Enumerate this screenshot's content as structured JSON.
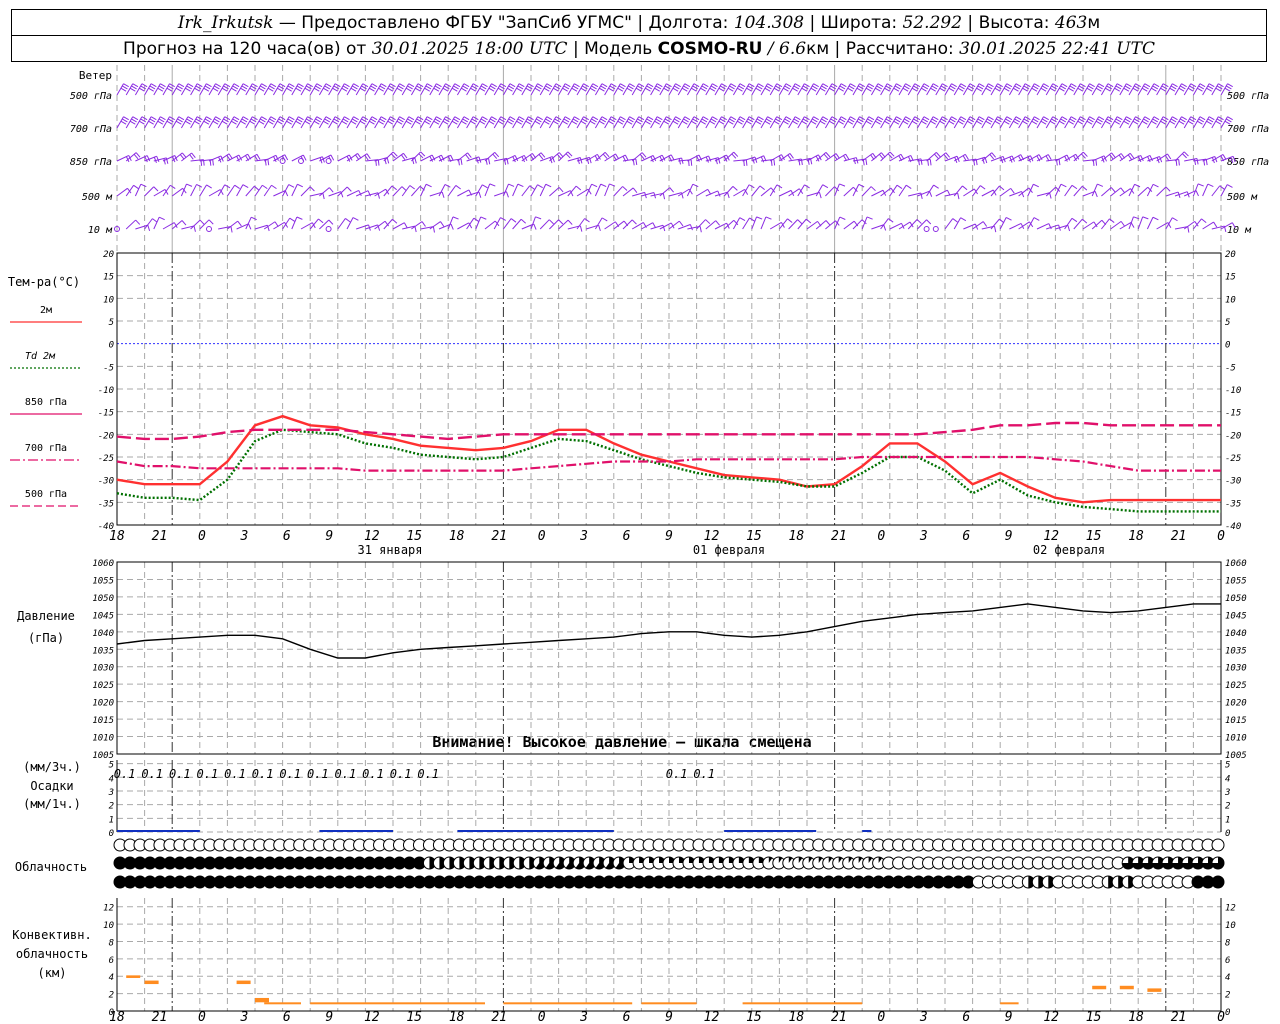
{
  "header": {
    "station": "Irk_Irkutsk",
    "provider": "— Предоставлено ФГБУ \"ЗапСиб УГМС\"",
    "lon_label": "Долгота:",
    "lon_value": "104.308",
    "lat_label": "Широта:",
    "lat_value": "52.292",
    "alt_label": "Высота:",
    "alt_value": "463",
    "alt_unit": "м",
    "forecast_label": "Прогноз на 120 часа(ов) от",
    "forecast_start": "30.01.2025 18:00 UTC",
    "model_label": "Модель",
    "model_name": "COSMO-RU",
    "model_res": "/ 6.6",
    "model_res_unit": "км",
    "computed_label": "Рассчитано:",
    "computed_value": "30.01.2025 22:41 UTC"
  },
  "wind_panel": {
    "title": "Ветер",
    "levels": [
      "500 гПа",
      "700 гПа",
      "850 гПа",
      "500 м",
      "10 м"
    ],
    "color": "#8a2be2"
  },
  "temp_panel": {
    "title": "Тем-ра(°C)",
    "legend": [
      {
        "label": "2м",
        "color": "#ff3030",
        "dash": "solid"
      },
      {
        "label": "Td 2м",
        "color": "#007000",
        "dash": "dot"
      },
      {
        "label": "850 гПа",
        "color": "#e0106a",
        "dash": "solid"
      },
      {
        "label": "700 гПа",
        "color": "#e0106a",
        "dash": "dashdot"
      },
      {
        "label": "500 гПа",
        "color": "#e0106a",
        "dash": "dash"
      }
    ],
    "yticks": [
      "20",
      "15",
      "10",
      "5",
      "0",
      "-5",
      "-10",
      "-15",
      "-20",
      "-25",
      "-30",
      "-35",
      "-40"
    ]
  },
  "x_axis": {
    "hour_labels": [
      "18",
      "21",
      "0",
      "3",
      "6",
      "9",
      "12",
      "15",
      "18",
      "21",
      "0",
      "3",
      "6",
      "9",
      "12",
      "15",
      "18",
      "21",
      "0",
      "3",
      "6",
      "9",
      "12",
      "15",
      "18",
      "21",
      "0"
    ],
    "date_labels": [
      "31 января",
      "01 февраля",
      "02 февраля"
    ]
  },
  "pressure_panel": {
    "title": "Давление",
    "unit": "(гПа)",
    "yticks": [
      "1060",
      "1055",
      "1050",
      "1045",
      "1040",
      "1035",
      "1030",
      "1025",
      "1020",
      "1015",
      "1010",
      "1005"
    ],
    "warning": "Внимание! Высокое давление — шкала смещена"
  },
  "precip_panel": {
    "label_3h": "(мм/3ч.)",
    "title": "Осадки",
    "label_1h": "(мм/1ч.)",
    "yticks": [
      "5",
      "4",
      "3",
      "2",
      "1",
      "0"
    ],
    "amounts": [
      "0.1",
      "0.1",
      "0.1",
      "0.1",
      "0.1",
      "0.1",
      "0.1",
      "0.1",
      "0.1",
      "0.1",
      "0.1",
      "0.1",
      "0.1",
      "0.1"
    ]
  },
  "cloud_panel": {
    "title": "Облачность"
  },
  "conv_panel": {
    "title_1": "Конвективн.",
    "title_2": "облачность",
    "unit": "(км)",
    "yticks": [
      "12",
      "10",
      "8",
      "6",
      "4",
      "2",
      "0"
    ]
  },
  "chart_data": [
    {
      "type": "line",
      "title": "Тем-ра(°C)",
      "x_hours": [
        0,
        3,
        6,
        9,
        12,
        15,
        18,
        21,
        24,
        27,
        30,
        33,
        36,
        39,
        42,
        45,
        48,
        51,
        54,
        57,
        60,
        63,
        66,
        69,
        72,
        75,
        78,
        81,
        84,
        87,
        90,
        93,
        96,
        99,
        102,
        105,
        108,
        111,
        114,
        117,
        120
      ],
      "ylim": [
        -40,
        20
      ],
      "series": [
        {
          "name": "2м",
          "values": [
            -30,
            -31,
            -31,
            -31,
            -26,
            -18,
            -16,
            -18,
            -18.5,
            -20,
            -21,
            -22.5,
            -23,
            -23.5,
            -23,
            -21.5,
            -19,
            -19,
            -22,
            -24.5,
            -26,
            -27.5,
            -29,
            -29.5,
            -30,
            -31.5,
            -31,
            -27,
            -22,
            -22,
            -26,
            -31,
            -28.5,
            -31.5,
            -34,
            -35,
            -34.5,
            -34.5,
            -34.5,
            -34.5,
            -34.5
          ]
        },
        {
          "name": "Td 2м",
          "values": [
            -33,
            -34,
            -34,
            -34.5,
            -30,
            -21.5,
            -19,
            -19.5,
            -20,
            -22,
            -23,
            -24.5,
            -25,
            -25.5,
            -25,
            -23,
            -21,
            -21.5,
            -23.5,
            -25.5,
            -27,
            -28.5,
            -29.5,
            -30,
            -30.5,
            -31.5,
            -31.5,
            -28.5,
            -25,
            -25,
            -28,
            -33,
            -30,
            -33.5,
            -35,
            -36,
            -36.5,
            -37,
            -37,
            -37,
            -37
          ]
        },
        {
          "name": "850 гПа",
          "values": [
            -20.5,
            -21,
            -21,
            -20.5,
            -19.5,
            -19,
            -19,
            -19,
            -19,
            -19.5,
            -20,
            -20.5,
            -21,
            -20.5,
            -20,
            -20,
            -20,
            -20,
            -20,
            -20,
            -20,
            -20,
            -20,
            -20,
            -20,
            -20,
            -20,
            -20,
            -20,
            -20,
            -19.5,
            -19,
            -18,
            -18,
            -17.5,
            -17.5,
            -18,
            -18,
            -18,
            -18,
            -18
          ]
        },
        {
          "name": "700 гПа",
          "values": [
            -26,
            -27,
            -27,
            -27.5,
            -27.5,
            -27.5,
            -27.5,
            -27.5,
            -27.5,
            -28,
            -28,
            -28,
            -28,
            -28,
            -28,
            -27.5,
            -27,
            -26.5,
            -26,
            -26,
            -26,
            -25.5,
            -25.5,
            -25.5,
            -25.5,
            -25.5,
            -25.5,
            -25,
            -25,
            -25,
            -25,
            -25,
            -25,
            -25,
            -25.5,
            -26,
            -27,
            -28,
            -28,
            -28,
            -28
          ]
        }
      ]
    },
    {
      "type": "line",
      "title": "Давление",
      "x_hours": [
        0,
        3,
        6,
        9,
        12,
        15,
        18,
        21,
        24,
        27,
        30,
        33,
        36,
        39,
        42,
        45,
        48,
        51,
        54,
        57,
        60,
        63,
        66,
        69,
        72,
        75,
        78,
        81,
        84,
        87,
        90,
        93,
        96,
        99,
        102,
        105,
        108,
        111,
        114,
        117,
        120
      ],
      "ylim": [
        1005,
        1060
      ],
      "series": [
        {
          "name": "Давление",
          "values": [
            1036.5,
            1037.5,
            1038,
            1038.5,
            1039,
            1039,
            1038,
            1035,
            1032.5,
            1032.5,
            1034,
            1035,
            1035.5,
            1036,
            1036.5,
            1037,
            1037.5,
            1038,
            1038.5,
            1039.5,
            1040,
            1040,
            1039,
            1038.5,
            1039,
            1040,
            1041.5,
            1043,
            1044,
            1045,
            1045.5,
            1046,
            1047,
            1048,
            1047,
            1046,
            1045.5,
            1046,
            1047,
            1048,
            1048
          ]
        }
      ]
    },
    {
      "type": "bar",
      "title": "Осадки",
      "ylim": [
        0,
        5
      ],
      "values_mm_per_3h": [
        0.1,
        0.1,
        0.1,
        0.1,
        0.1,
        0.1,
        0.1,
        0.1,
        0.1,
        0.1,
        0.1,
        0.1,
        0,
        0,
        0,
        0.1,
        0.1
      ]
    },
    {
      "type": "bar",
      "title": "Конвективн. облачность",
      "ylim": [
        0,
        13
      ],
      "segments_km": [
        {
          "h": 1,
          "bottom": 3.8,
          "top": 4.1
        },
        {
          "h": 3,
          "bottom": 3.1,
          "top": 3.5
        },
        {
          "h": 13,
          "bottom": 3.1,
          "top": 3.5
        },
        {
          "h": 15,
          "bottom": 1.0,
          "top": 1.5
        },
        {
          "h": 106,
          "bottom": 2.5,
          "top": 2.9
        },
        {
          "h": 109,
          "bottom": 2.5,
          "top": 2.9
        },
        {
          "h": 112,
          "bottom": 2.2,
          "top": 2.6
        }
      ]
    }
  ]
}
